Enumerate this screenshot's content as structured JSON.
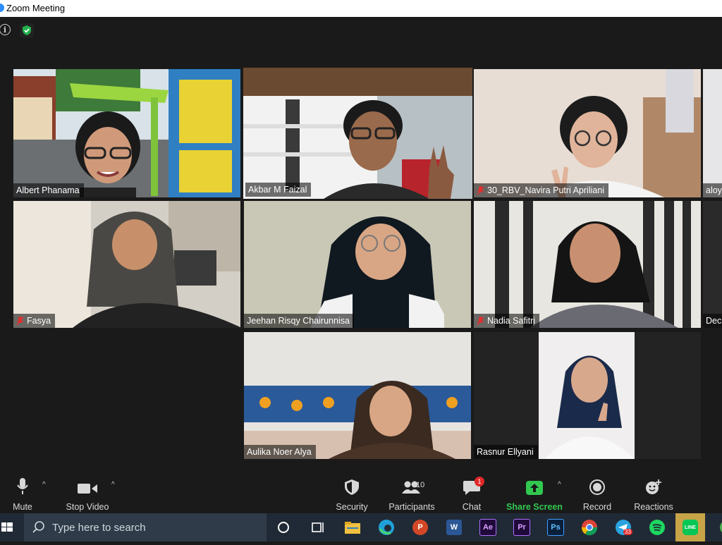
{
  "window": {
    "title": "Zoom Meeting"
  },
  "participants": [
    {
      "name": "Albert Phanama",
      "muted": false,
      "active": false
    },
    {
      "name": "Akbar M Faizal",
      "muted": false,
      "active": true
    },
    {
      "name": "30_RBV_Navira Putri Apriliani",
      "muted": true,
      "active": false
    },
    {
      "name": "aloy",
      "muted": false,
      "active": false
    },
    {
      "name": "Fasya",
      "muted": true,
      "active": false
    },
    {
      "name": "Jeehan Risqy Chairunnisa",
      "muted": false,
      "active": false
    },
    {
      "name": "Nadia Safitri",
      "muted": true,
      "active": false
    },
    {
      "name": "Dec",
      "muted": false,
      "active": false
    },
    {
      "name": "Aulika Noer Alya",
      "muted": false,
      "active": false
    },
    {
      "name": "Rasnur Ellyani",
      "muted": false,
      "active": false
    }
  ],
  "toolbar": {
    "mute": "Mute",
    "stop_video": "Stop Video",
    "security": "Security",
    "participants": "Participants",
    "participants_count": "10",
    "chat": "Chat",
    "chat_badge": "1",
    "share_screen": "Share Screen",
    "record": "Record",
    "reactions": "Reactions"
  },
  "taskbar": {
    "search_placeholder": "Type here to search",
    "telegram_badge": "33"
  },
  "colors": {
    "active_speaker": "#c8e65a",
    "share_green": "#32c850",
    "badge_red": "#e02828",
    "taskbar": "#202a36"
  },
  "icons": {
    "encryption": "shield-check-icon",
    "info": "info-icon"
  }
}
